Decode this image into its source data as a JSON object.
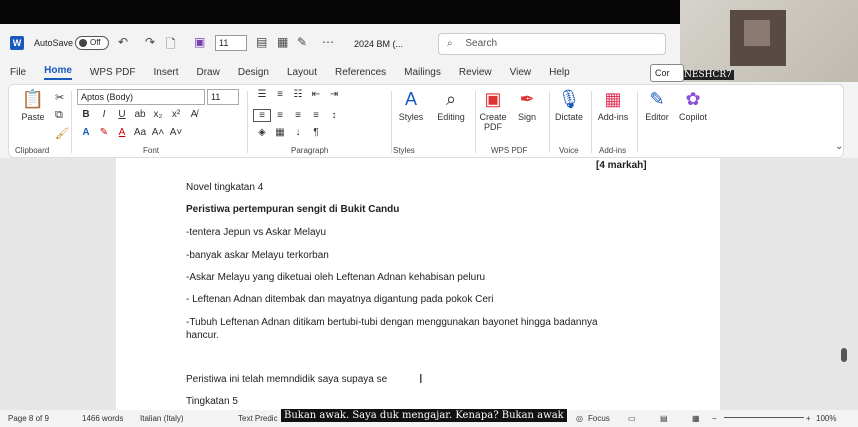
{
  "title_bar": {
    "app_icon": "word-icon",
    "autosave_label": "AutoSave",
    "autosave_state": "Off",
    "font_size_quick": "11",
    "document_name": "2024 BM (...",
    "search_placeholder": "Search"
  },
  "webcam": {
    "participant_name": "NESHCR7"
  },
  "menu": {
    "tabs": [
      "File",
      "Home",
      "WPS PDF",
      "Insert",
      "Draw",
      "Design",
      "Layout",
      "References",
      "Mailings",
      "Review",
      "View",
      "Help"
    ],
    "active": "Home",
    "comments_label": "Cor"
  },
  "ribbon": {
    "paste_label": "Paste",
    "clipboard_label": "Clipboard",
    "font_name": "Aptos (Body)",
    "font_size": "11",
    "font_label": "Font",
    "paragraph_label": "Paragraph",
    "styles_label": "Styles",
    "styles_group_label": "Styles",
    "editing_label": "Editing",
    "create_pdf_label": "Create PDF",
    "sign_label": "Sign",
    "wps_label": "WPS PDF",
    "dictate_label": "Dictate",
    "voice_label": "Voice",
    "addins_label": "Add-ins",
    "addins_group_label": "Add-ins",
    "editor_label": "Editor",
    "copilot_label": "Copilot"
  },
  "document": {
    "markah": "[4 markah]",
    "lines": [
      "Novel tingkatan 4",
      "Peristiwa pertempuran sengit di Bukit Candu",
      "-tentera Jepun vs Askar Melayu",
      "-banyak askar Melayu terkorban",
      "-Askar Melayu yang diketuai oleh Leftenan Adnan kehabisan peluru",
      "- Leftenan Adnan ditembak dan mayatnya digantung pada pokok Ceri",
      "-Tubuh Leftenan Adnan ditikam bertubi-tubi dengan menggunakan bayonet hingga badannya",
      "hancur.",
      "Peristiwa ini telah memndidik saya supaya se",
      "Tingkatan 5"
    ]
  },
  "status_bar": {
    "page": "Page 8 of 9",
    "words": "1466 words",
    "language": "Italian (Italy)",
    "text_predict": "Text Predic",
    "focus": "Focus",
    "zoom": "100%"
  },
  "caption": "Bukan awak. Saya duk mengajar. Kenapa? Bukan awak"
}
